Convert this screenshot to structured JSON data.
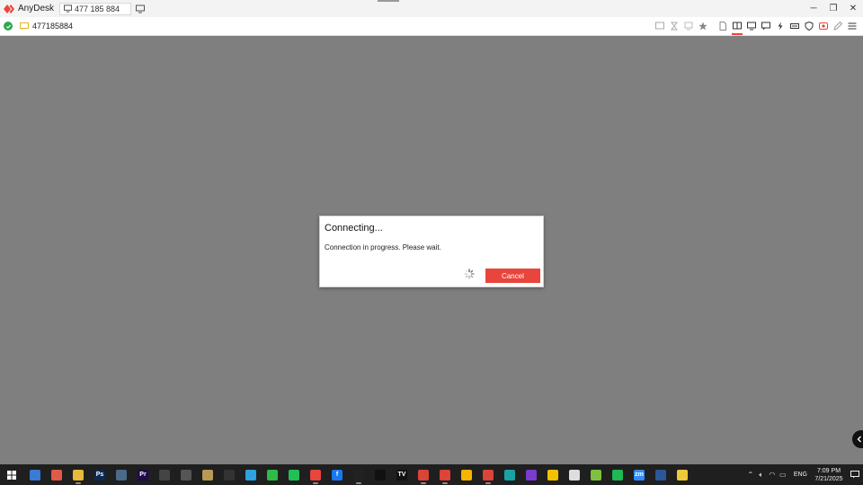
{
  "app": {
    "name": "AnyDesk",
    "tab_label": "477 185 884",
    "accent": "#ef443b"
  },
  "toolbar": {
    "address": "477185884",
    "status_color": "#2fa84f"
  },
  "dialog": {
    "title": "Connecting...",
    "message": "Connection in progress. Please wait.",
    "cancel_label": "Cancel",
    "cancel_color": "#e8453c"
  },
  "taskbar": {
    "time": "7:09 PM",
    "date": "7/21/2025",
    "language": "ENG",
    "apps": [
      {
        "name": "copilot",
        "label": "",
        "color": "#3a7bd5",
        "running": false
      },
      {
        "name": "notes",
        "label": "",
        "color": "#e05a47",
        "running": false
      },
      {
        "name": "file-explorer",
        "label": "",
        "color": "#e8b93a",
        "running": true
      },
      {
        "name": "photoshop",
        "label": "Ps",
        "color": "#0a2a52",
        "running": false
      },
      {
        "name": "calculator",
        "label": "",
        "color": "#4a6a8a",
        "running": false
      },
      {
        "name": "premiere",
        "label": "Pr",
        "color": "#1f0a4a",
        "running": false
      },
      {
        "name": "capture",
        "label": "",
        "color": "#444",
        "running": false
      },
      {
        "name": "clock",
        "label": "",
        "color": "#555",
        "running": false
      },
      {
        "name": "media",
        "label": "",
        "color": "#b89a55",
        "running": false
      },
      {
        "name": "terminal",
        "label": "",
        "color": "#333",
        "running": false
      },
      {
        "name": "telegram",
        "label": "",
        "color": "#2aa3e0",
        "running": false
      },
      {
        "name": "wechat",
        "label": "",
        "color": "#2dbb4a",
        "running": false
      },
      {
        "name": "line",
        "label": "",
        "color": "#1fc155",
        "running": false
      },
      {
        "name": "anydesk",
        "label": "",
        "color": "#e8453c",
        "running": true
      },
      {
        "name": "facebook",
        "label": "f",
        "color": "#1877f2",
        "running": false
      },
      {
        "name": "capcut",
        "label": "",
        "color": "#222",
        "running": true
      },
      {
        "name": "tiktok",
        "label": "",
        "color": "#111",
        "running": false
      },
      {
        "name": "tradingview",
        "label": "TV",
        "color": "#111",
        "running": false
      },
      {
        "name": "chrome-1",
        "label": "",
        "color": "#db4437",
        "running": true
      },
      {
        "name": "chrome-2",
        "label": "",
        "color": "#db4437",
        "running": true
      },
      {
        "name": "chrome-3",
        "label": "",
        "color": "#f4b400",
        "running": false
      },
      {
        "name": "chrome-4",
        "label": "",
        "color": "#db4437",
        "running": true
      },
      {
        "name": "edge",
        "label": "",
        "color": "#1aa3a3",
        "running": false
      },
      {
        "name": "stripes-app",
        "label": "",
        "color": "#7a3bd0",
        "running": false
      },
      {
        "name": "sticky-notes",
        "label": "",
        "color": "#f2c200",
        "running": false
      },
      {
        "name": "circle-app",
        "label": "",
        "color": "#ddd",
        "running": false
      },
      {
        "name": "upload-app",
        "label": "",
        "color": "#7ec040",
        "running": false
      },
      {
        "name": "spotify",
        "label": "",
        "color": "#1db954",
        "running": false
      },
      {
        "name": "zoom",
        "label": "zm",
        "color": "#2d8cff",
        "running": false
      },
      {
        "name": "word",
        "label": "",
        "color": "#2b579a",
        "running": false
      },
      {
        "name": "python",
        "label": "",
        "color": "#f0c93a",
        "running": false
      }
    ]
  }
}
